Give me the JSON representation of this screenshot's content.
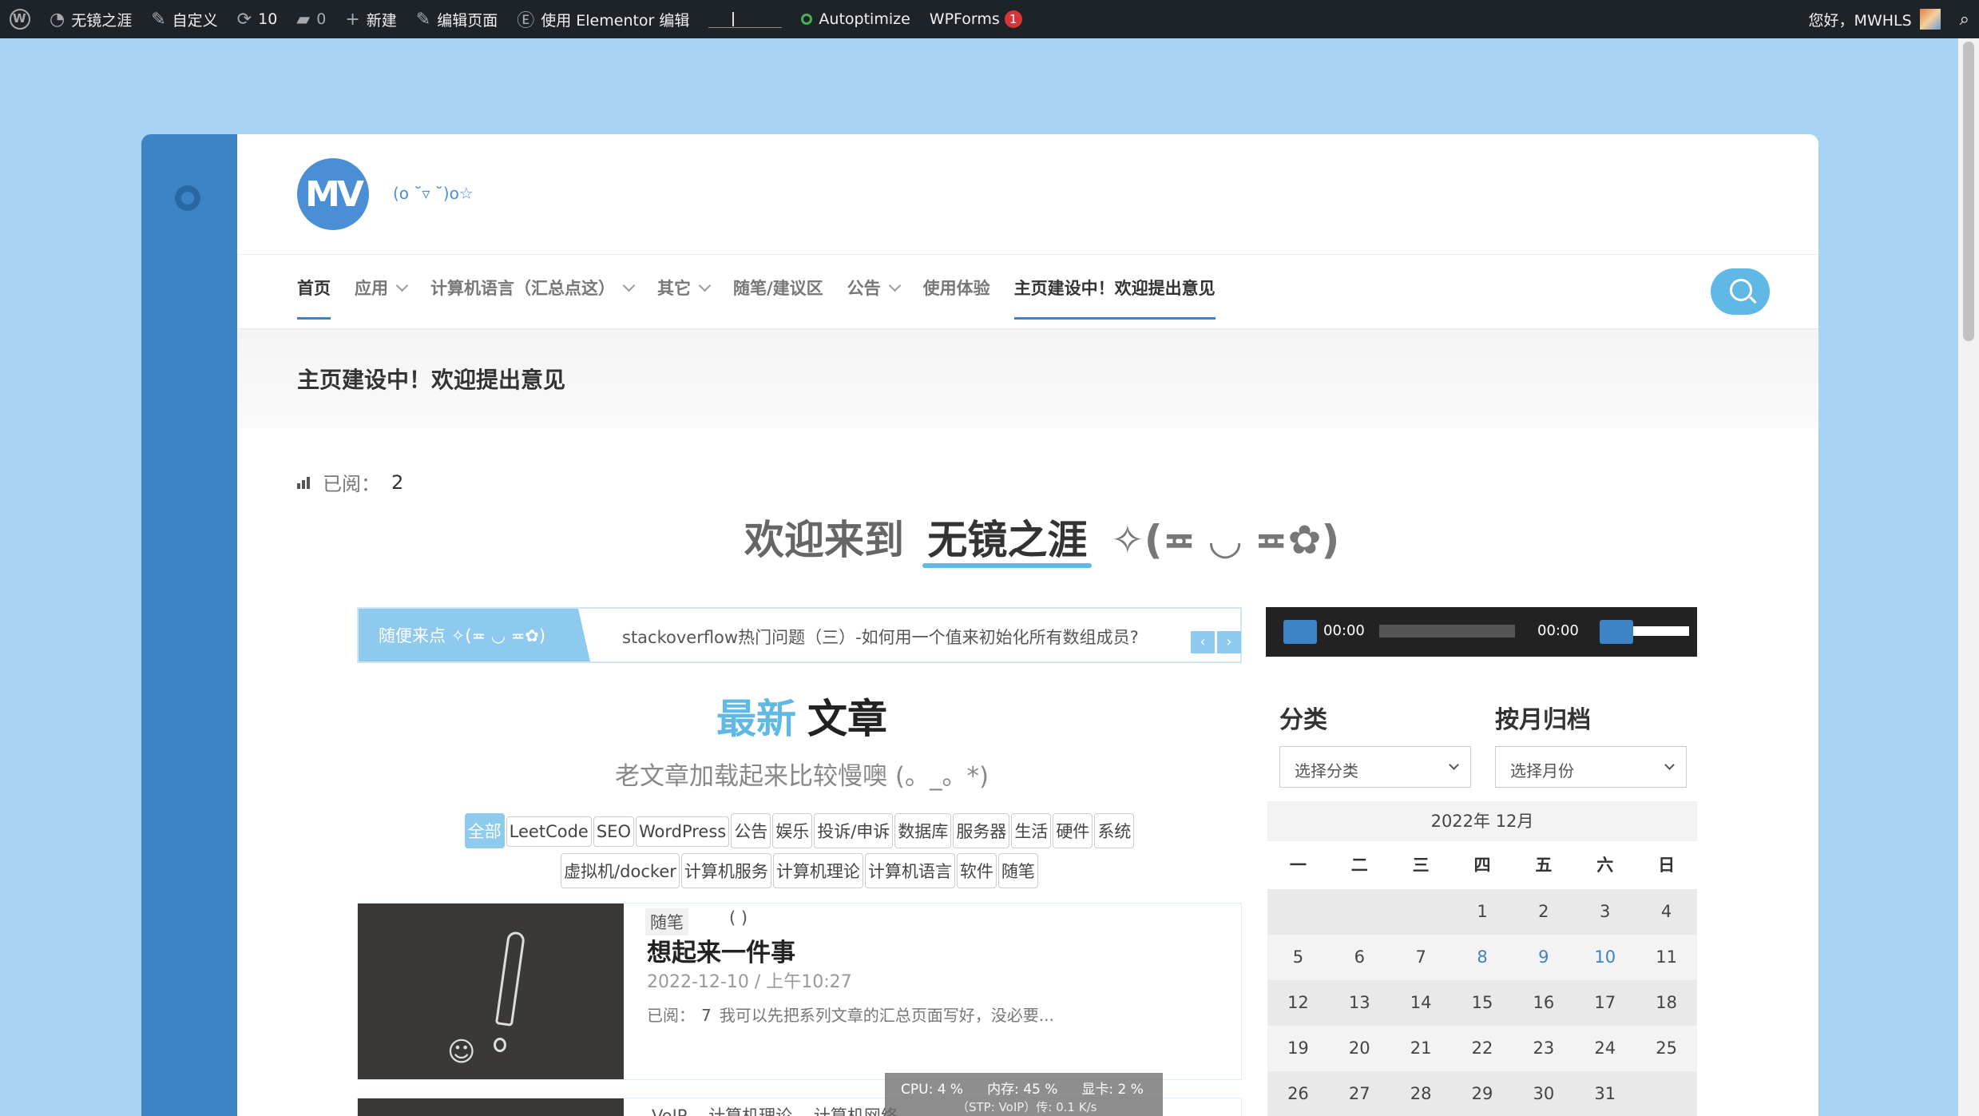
{
  "adminbar": {
    "site_name": "无镜之涯",
    "customize": "自定义",
    "updates": "10",
    "comments": "0",
    "new": "新建",
    "edit_page": "编辑页面",
    "elementor": "使用 Elementor 编辑",
    "autoptimize": "Autoptimize",
    "wpforms": "WPForms",
    "wpforms_badge": "1",
    "greeting": "您好，MWHLS"
  },
  "header": {
    "logo_text": "MV",
    "tagline": "(o ˘▿ ˘)o☆"
  },
  "nav": {
    "items": [
      {
        "label": "首页"
      },
      {
        "label": "应用"
      },
      {
        "label": "计算机语言（汇总点这）"
      },
      {
        "label": "其它"
      },
      {
        "label": "随笔/建议区"
      },
      {
        "label": "公告"
      },
      {
        "label": "使用体验"
      },
      {
        "label": "主页建设中！欢迎提出意见"
      }
    ]
  },
  "page": {
    "title": "主页建设中！欢迎提出意见",
    "views_label": "已阅：",
    "views_count": "2",
    "welcome_prefix": "欢迎来到",
    "welcome_site": "无镜之涯",
    "welcome_kaomoji": "✧(≖ ◡ ≖✿)"
  },
  "ticker": {
    "label": "随便来点 ✧(≖ ◡ ≖✿)",
    "text": "stackoverflow热门问题（三）-如何用一个值来初始化所有数组成员?",
    "prev": "‹",
    "next": "›"
  },
  "audio": {
    "current": "00:00",
    "duration": "00:00"
  },
  "latest": {
    "title_highlight": "最新",
    "title": "文章",
    "subtitle": "老文章加载起来比较慢噢 (。_。*)",
    "chips": [
      "全部",
      "LeetCode",
      "SEO",
      "WordPress",
      "公告",
      "娱乐",
      "投诉/申诉",
      "数据库",
      "服务器",
      "生活",
      "硬件",
      "系统",
      "虚拟机/docker",
      "计算机服务",
      "计算机理论",
      "计算机语言",
      "软件",
      "随笔"
    ]
  },
  "post1": {
    "category": "随笔",
    "paren": "( )",
    "title": "想起来一件事",
    "date": "2022-12-10 / 上午10:27",
    "views_label": "已阅：",
    "views": "7",
    "excerpt": "我可以先把系列文章的汇总页面写好，没必要..."
  },
  "post2": {
    "categories": "VoIP    计算机理论    计算机网络"
  },
  "widgets": {
    "category_title": "分类",
    "category_select": "选择分类",
    "archive_title": "按月归档",
    "archive_select": "选择月份"
  },
  "calendar": {
    "caption": "2022年 12月",
    "weekdays": [
      "一",
      "二",
      "三",
      "四",
      "五",
      "六",
      "日"
    ],
    "weeks": [
      [
        "",
        "",
        "",
        "1",
        "2",
        "3",
        "4"
      ],
      [
        "5",
        "6",
        "7",
        "8",
        "9",
        "10",
        "11"
      ],
      [
        "12",
        "13",
        "14",
        "15",
        "16",
        "17",
        "18"
      ],
      [
        "19",
        "20",
        "21",
        "22",
        "23",
        "24",
        "25"
      ],
      [
        "26",
        "27",
        "28",
        "29",
        "30",
        "31",
        ""
      ]
    ],
    "linked_days": [
      "8",
      "9",
      "10"
    ]
  },
  "monitor": {
    "cpu": "CPU: 4 %",
    "memory": "内存: 45 %",
    "gpu": "显卡: 2 %",
    "extra": "（STP: VoIP）传: 0.1 K/s"
  }
}
